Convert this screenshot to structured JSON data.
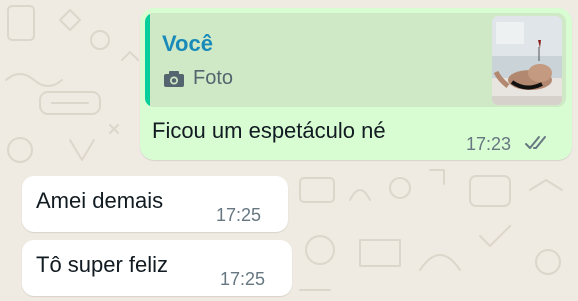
{
  "chat": {
    "outgoing": {
      "quote": {
        "author": "Você",
        "type_label": "Foto",
        "type_icon": "camera-icon"
      },
      "text": "Ficou um espetáculo né",
      "time": "17:23",
      "status": "read-double-check"
    },
    "incoming": [
      {
        "text": "Amei demais",
        "time": "17:25"
      },
      {
        "text": "Tô super feliz",
        "time": "17:25"
      }
    ]
  },
  "colors": {
    "wallpaper": "#efeae2",
    "outgoing_bubble": "#d9fdd3",
    "incoming_bubble": "#ffffff",
    "quote_bar": "#06cf9c",
    "quote_author": "#1a8bb8",
    "timestamp": "#667781"
  }
}
